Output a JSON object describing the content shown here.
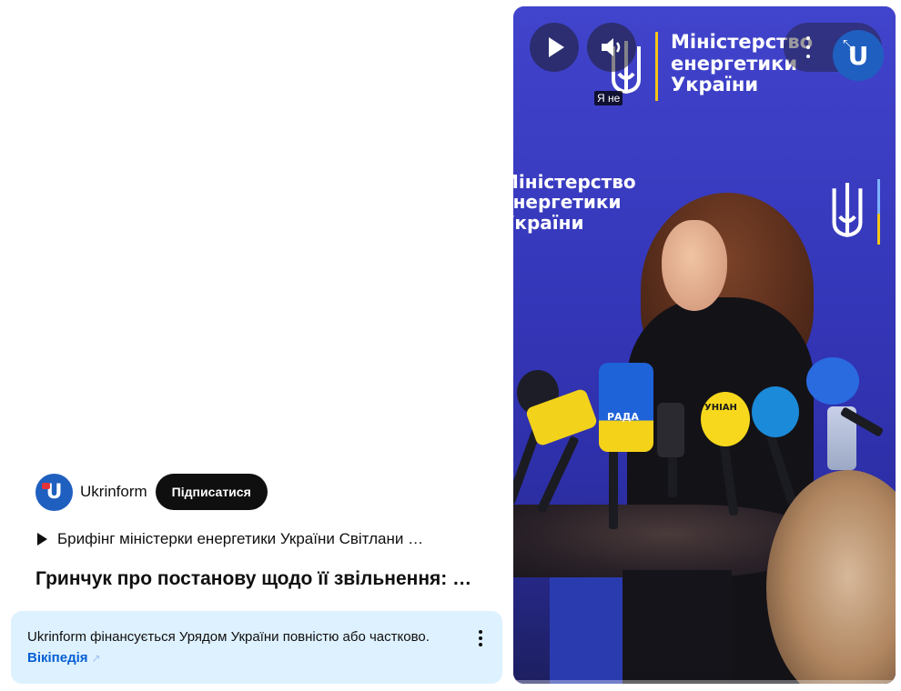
{
  "channel": {
    "name": "Ukrinform",
    "subscribe_label": "Підписатися"
  },
  "playlist": {
    "text": "Брифінг міністерки енергетики України Світлани …"
  },
  "video": {
    "title": "Гринчук про постанову щодо її звільнення: …"
  },
  "info_panel": {
    "text": "Ukrinform фінансується Урядом України повністю або частково.",
    "link_label": "Вікіпедія"
  },
  "player": {
    "backdrop_text_top": [
      "Міністерство",
      "енергетики",
      "України"
    ],
    "backdrop_text_left": [
      "Міністерство",
      "енергетики",
      "України"
    ],
    "mute_label": "Я не",
    "mic_label": "РАДА",
    "mic_label2": "УНІАН",
    "progress": 0.01,
    "colors": {
      "backdrop": "#3a3ec5",
      "accent_red": "#ff0033"
    }
  }
}
